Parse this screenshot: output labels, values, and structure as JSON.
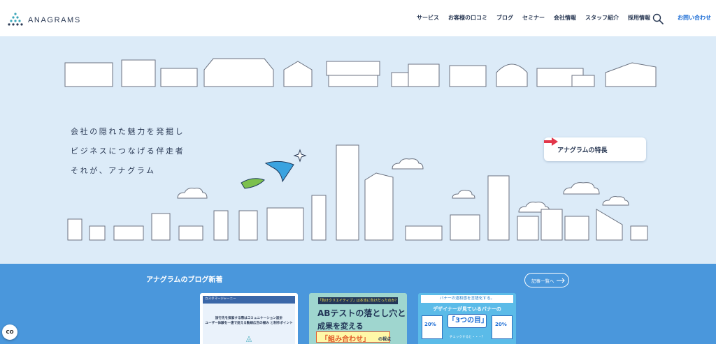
{
  "header": {
    "logo_text": "ANAGRAMS",
    "nav": [
      "サービス",
      "お客様の口コミ",
      "ブログ",
      "セミナー",
      "会社情報",
      "スタッフ紹介",
      "採用情報"
    ],
    "contact_label": "お問い合わせ"
  },
  "hero": {
    "tagline": [
      "会社の隠れた魅力を発掘し",
      "ビジネスにつなげる伴走者",
      "それが、アナグラム"
    ],
    "feature_button_label": "アナグラムの特長"
  },
  "blog": {
    "title": "アナグラムのブログ新着",
    "all_posts_label": "記事一覧へ",
    "cards": {
      "card1": {
        "tag": "カスタマージャーニー",
        "line1": "旅行先を探索する際はコミュニケーション設計",
        "line2": "ユーザー体験を一連で捉える動線広告の極み と制作ポイント"
      },
      "card2": {
        "tag": "「負けクリエイティブ」は本当に負けだったのか？",
        "line1": "ABテストの落とし穴と",
        "line2": "成果を変える",
        "line3": "「組み合わせ」",
        "line4": "の視点"
      },
      "card3": {
        "top": "バナーの違和感を言語化する。",
        "line2": "デザイナーが見ているバナーの",
        "big": "「3つの目」",
        "pct_left": "20%",
        "pct_right": "20%",
        "check": "チェックすると・・・？"
      }
    }
  },
  "cc_button_label": "CO"
}
